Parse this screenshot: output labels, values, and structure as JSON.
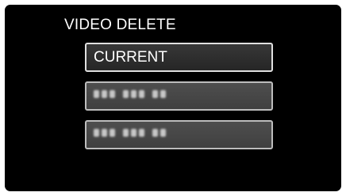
{
  "screen": {
    "title": "VIDEO DELETE"
  },
  "menu": {
    "items": [
      {
        "label": "CURRENT",
        "selected": true
      },
      {
        "label": "",
        "obscured": true,
        "selected": false
      },
      {
        "label": "",
        "obscured": true,
        "selected": false
      }
    ]
  }
}
